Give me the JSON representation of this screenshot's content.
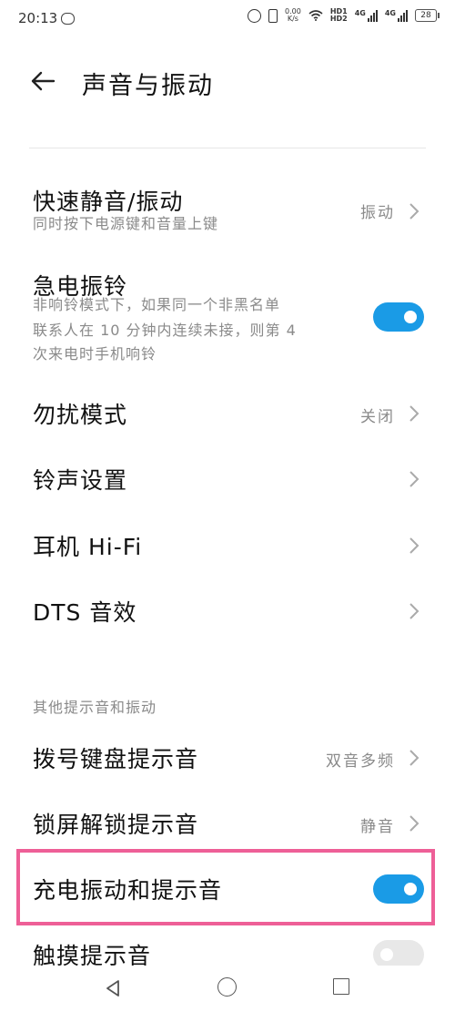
{
  "status_bar": {
    "time": "20:13",
    "net_speed_top": "0.00",
    "net_speed_bottom": "K/s",
    "hd_top": "HD1",
    "hd_bottom": "HD2",
    "sim1": "4G",
    "sim2": "4G",
    "battery": "28"
  },
  "header": {
    "title": "声音与振动"
  },
  "rows": {
    "quick_mute": {
      "title": "快速静音/振动",
      "subtitle": "同时按下电源键和音量上键",
      "value": "振动"
    },
    "urgent_ring": {
      "title": "急电振铃",
      "subtitle_line1": "非响铃模式下，如果同一个非黑名单",
      "subtitle_line2": "联系人在 10 分钟内连续未接，则第 4",
      "subtitle_line3": "次来电时手机响铃",
      "toggle_on": true
    },
    "dnd": {
      "title": "勿扰模式",
      "value": "关闭"
    },
    "ringtone": {
      "title": "铃声设置"
    },
    "hifi": {
      "title": "耳机 Hi-Fi"
    },
    "dts": {
      "title": "DTS 音效"
    },
    "section_other": "其他提示音和振动",
    "dialpad": {
      "title": "拨号键盘提示音",
      "value": "双音多频"
    },
    "lock_sound": {
      "title": "锁屏解锁提示音",
      "value": "静音"
    },
    "charge_vibe": {
      "title": "充电振动和提示音",
      "toggle_on": true
    },
    "touch_sound": {
      "title": "触摸提示音",
      "toggle_on": false
    }
  },
  "colors": {
    "accent": "#1a9be6",
    "highlight": "#ee5f97"
  }
}
